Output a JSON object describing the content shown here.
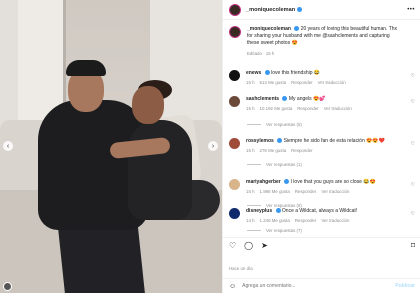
{
  "post": {
    "header": {
      "username": "_moniquecoleman",
      "more_icon": "more-icon"
    },
    "caption": {
      "username": "_moniquecoleman",
      "text": "20 years of loving this beautiful human. Thx for sharing your husband with me @sashclements and capturing these sweet photos 😍",
      "meta": "Editado · 15 h"
    },
    "comments": [
      {
        "username": "enews",
        "text": "love this friendship 😂",
        "time": "15 h",
        "likes": "513 Me gusta",
        "reply": "Responder",
        "translate": "Ver traducción",
        "replies": ""
      },
      {
        "username": "sashclements",
        "text": "My angels 😍💕",
        "time": "15 h",
        "likes": "10.192 Me gusta",
        "reply": "Responder",
        "translate": "Ver traducción",
        "replies": "Ver respuestas (5)"
      },
      {
        "username": "rossylemos",
        "text": "Siempre he sido fan de esta relación 😍😍❤️",
        "time": "15 h",
        "likes": "278 Me gusta",
        "reply": "Responder",
        "translate": "",
        "replies": "Ver respuestas (1)"
      },
      {
        "username": "mariyahgerber",
        "text": "I love that you guys are so close 😂😍",
        "time": "15 h",
        "likes": "1.986 Me gusta",
        "reply": "Responder",
        "translate": "Ver traducción",
        "replies": "Ver respuestas (8)"
      },
      {
        "username": "disneyplus",
        "text": "Once a Wildcat, always a Wildcat!",
        "time": "14 h",
        "likes": "1.246 Me gusta",
        "reply": "Responder",
        "translate": "Ver traducción",
        "replies": "Ver respuestas (7)"
      }
    ],
    "time_ago": "Hace un día",
    "add_comment": {
      "placeholder": "Agrega un comentario...",
      "publish": "Publicar"
    },
    "colors": {
      "verified": "#3897f0",
      "liked": "#ed4956",
      "publish": "#b2dffc"
    }
  }
}
